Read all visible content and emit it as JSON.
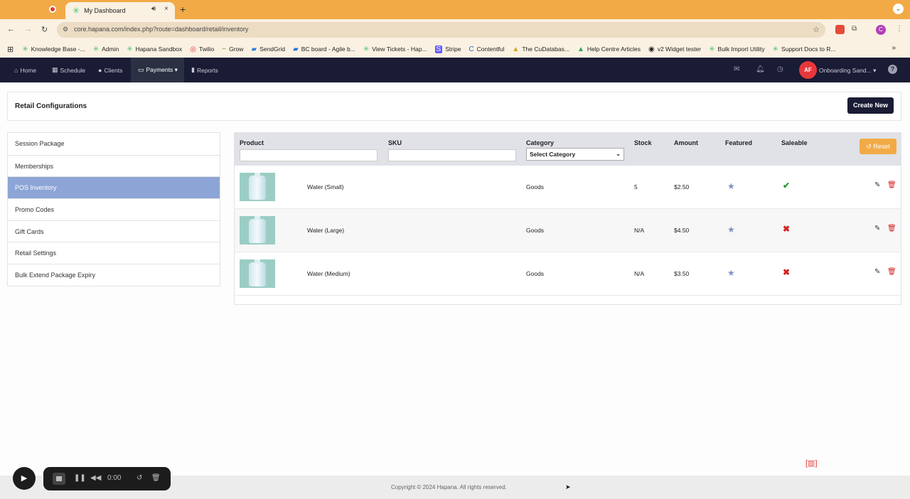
{
  "browser": {
    "tab_title": "My Dashboard",
    "tab_close": "×",
    "new_tab": "+",
    "url": "core.hapana.com/index.php?route=dashboard/retail/inventory",
    "bookmarks": [
      {
        "icon": "✳",
        "label": "Knowledge Base -..."
      },
      {
        "icon": "✳",
        "label": "Admin"
      },
      {
        "icon": "✳",
        "label": "Hapana Sandbox"
      },
      {
        "icon": "◎",
        "label": "Twilio"
      },
      {
        "icon": "~",
        "label": "Grow"
      },
      {
        "icon": "▰",
        "label": "SendGrid"
      },
      {
        "icon": "▰",
        "label": "BC board - Agile b..."
      },
      {
        "icon": "✳",
        "label": "View Tickets - Hap..."
      },
      {
        "icon": "S",
        "label": "Stripe"
      },
      {
        "icon": "C",
        "label": "Contentful"
      },
      {
        "icon": "▲",
        "label": "The CuDatabas..."
      },
      {
        "icon": "▲",
        "label": "Help Centre Articles"
      },
      {
        "icon": "◉",
        "label": "v2 Widget tester"
      },
      {
        "icon": "✳",
        "label": "Bulk Import Utility"
      },
      {
        "icon": "✳",
        "label": "Support Docs to R..."
      }
    ],
    "profile_initial": "C"
  },
  "nav": {
    "items": [
      {
        "icon": "⌂",
        "label": "Home"
      },
      {
        "icon": "▦",
        "label": "Schedule"
      },
      {
        "icon": "●",
        "label": "Clients"
      },
      {
        "icon": "▭",
        "label": "Payments ▾"
      },
      {
        "icon": "▮",
        "label": "Reports"
      }
    ],
    "avatar_initials": "AF",
    "account_label": "Onboarding Sand... ▾",
    "help": "?"
  },
  "page": {
    "title": "Retail Configurations",
    "create_button": "Create New"
  },
  "sidebar": {
    "items": [
      "Session Package",
      "Memberships",
      "POS Inventory",
      "Promo Codes",
      "Gift Cards",
      "Retail Settings",
      "Bulk Extend Package Expiry"
    ],
    "active": "POS Inventory"
  },
  "table": {
    "headers": {
      "product": "Product",
      "sku": "SKU",
      "category": "Category",
      "stock": "Stock",
      "amount": "Amount",
      "featured": "Featured",
      "saleable": "Saleable"
    },
    "category_select": "Select Category",
    "reset_label": "Reset",
    "rows": [
      {
        "name": "Water (Small)",
        "sku": "",
        "category": "Goods",
        "stock": "5",
        "amount": "$2.50",
        "featured": true,
        "saleable": true
      },
      {
        "name": "Water (Large)",
        "sku": "",
        "category": "Goods",
        "stock": "N/A",
        "amount": "$4.50",
        "featured": true,
        "saleable": false
      },
      {
        "name": "Water (Medium)",
        "sku": "",
        "category": "Goods",
        "stock": "N/A",
        "amount": "$3.50",
        "featured": true,
        "saleable": false
      }
    ]
  },
  "footer": {
    "copyright": "Copyright © 2024 Hapana. All rights reserved."
  },
  "recorder": {
    "time": "0:00"
  },
  "colors": {
    "browser_frame": "#f2aa46",
    "nav_bg": "#1a1b34",
    "active_sidebar": "#8da5d6",
    "reset_button": "#f2aa46",
    "saleable_yes": "#2e9a33",
    "saleable_no": "#d42020"
  }
}
